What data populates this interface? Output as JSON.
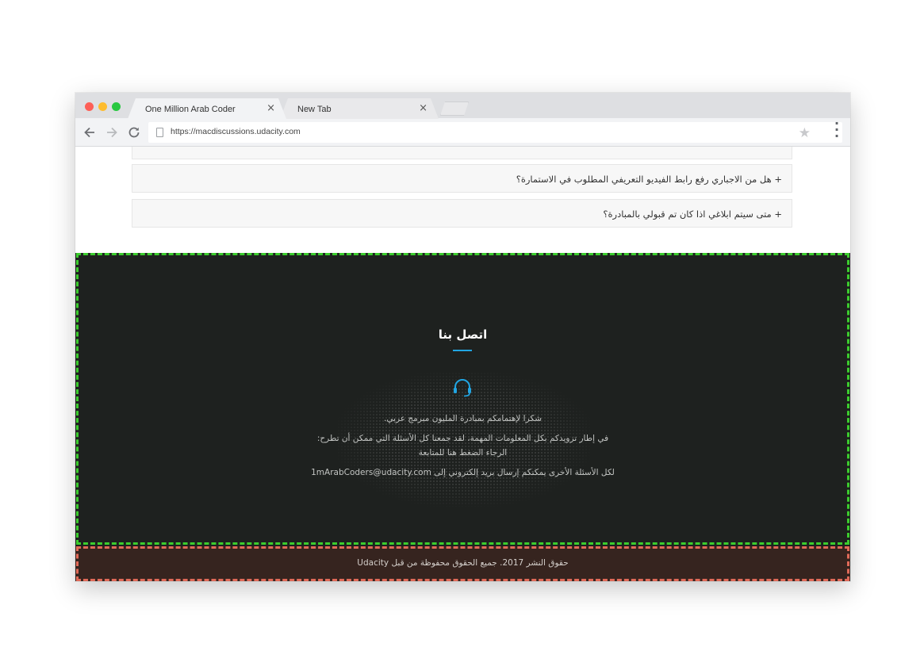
{
  "browser": {
    "tabs": [
      {
        "label": "One Million Arab Coder",
        "active": true
      },
      {
        "label": "New Tab",
        "active": false
      }
    ],
    "close_glyph": "×",
    "url": "https://macdiscussions.udacity.com",
    "icons": {
      "back": "arrow-left-icon",
      "forward": "arrow-right-icon",
      "reload": "reload-icon",
      "page": "page-icon",
      "bookmark": "star-icon",
      "menu": "kebab-menu-icon"
    }
  },
  "faq": {
    "items": [
      {
        "toggle": "+",
        "question": "هل من الاجباري رفع رابط الفيديو التعريفي المطلوب في الاستمارة؟"
      },
      {
        "toggle": "+",
        "question": "متى سيتم ابلاغي اذا كان تم قبولي بالمبادرة؟"
      }
    ]
  },
  "contact": {
    "title": "اتصل بنا",
    "accent_color": "#21a5e2",
    "icon": "headset-icon",
    "line1": "شكرا لإهتمامكم بمبادرة المليون مبرمج عربي.",
    "line2": "في إطار تزويدكم بكل المعلومات المهمة، لقد جمعنا كل الأسئلة التي ممكن أن تطرح:",
    "line3": "الرجاء الضغط هنا للمتابعة",
    "line4": "لكل الأسئلة الأخرى يمكنكم إرسال بريد إلكتروني إلى 1mArabCoders@udacity.com"
  },
  "footer": {
    "copyright": "حقوق النشر 2017. جميع الحقوق محفوظة من قبل Udacity"
  },
  "colors": {
    "contact_bg": "#1e211f",
    "footer_bg": "#36241f"
  }
}
